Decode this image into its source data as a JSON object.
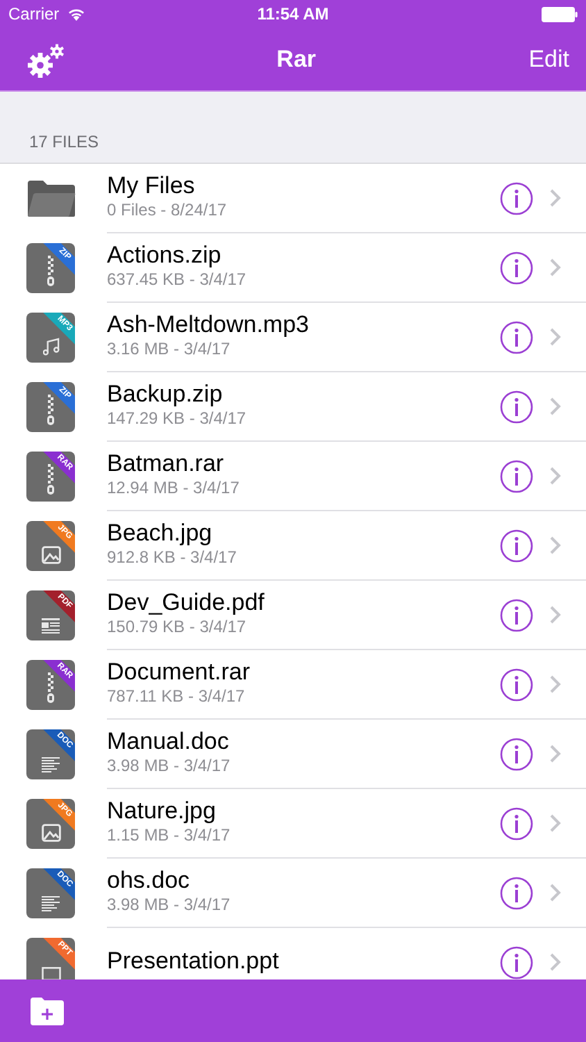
{
  "status_bar": {
    "carrier": "Carrier",
    "time": "11:54 AM"
  },
  "nav": {
    "title": "Rar",
    "edit": "Edit"
  },
  "section_header": "17 FILES",
  "files": [
    {
      "kind": "folder",
      "name": "My Files",
      "details": "0 Files - 8/24/17"
    },
    {
      "kind": "zip",
      "name": "Actions.zip",
      "details": "637.45 KB - 3/4/17",
      "badge": "ZIP",
      "color": "#2a6fd6"
    },
    {
      "kind": "audio",
      "name": "Ash-Meltdown.mp3",
      "details": "3.16 MB - 3/4/17",
      "badge": "MP3",
      "color": "#19a9b9"
    },
    {
      "kind": "zip",
      "name": "Backup.zip",
      "details": "147.29 KB - 3/4/17",
      "badge": "ZIP",
      "color": "#2a6fd6"
    },
    {
      "kind": "zip",
      "name": "Batman.rar",
      "details": "12.94 MB - 3/4/17",
      "badge": "RAR",
      "color": "#8a2fd0"
    },
    {
      "kind": "image",
      "name": "Beach.jpg",
      "details": "912.8 KB - 3/4/17",
      "badge": "JPG",
      "color": "#f07a20"
    },
    {
      "kind": "document",
      "name": "Dev_Guide.pdf",
      "details": "150.79 KB - 3/4/17",
      "badge": "PDF",
      "color": "#a3202c"
    },
    {
      "kind": "zip",
      "name": "Document.rar",
      "details": "787.11 KB - 3/4/17",
      "badge": "RAR",
      "color": "#8a2fd0"
    },
    {
      "kind": "text",
      "name": "Manual.doc",
      "details": "3.98 MB - 3/4/17",
      "badge": "DOC",
      "color": "#1a5cb8"
    },
    {
      "kind": "image",
      "name": "Nature.jpg",
      "details": "1.15 MB - 3/4/17",
      "badge": "JPG",
      "color": "#f07a20"
    },
    {
      "kind": "text",
      "name": "ohs.doc",
      "details": "3.98 MB - 3/4/17",
      "badge": "DOC",
      "color": "#1a5cb8"
    },
    {
      "kind": "slides",
      "name": "Presentation.ppt",
      "badge": "PPT",
      "color": "#f06a30"
    }
  ]
}
